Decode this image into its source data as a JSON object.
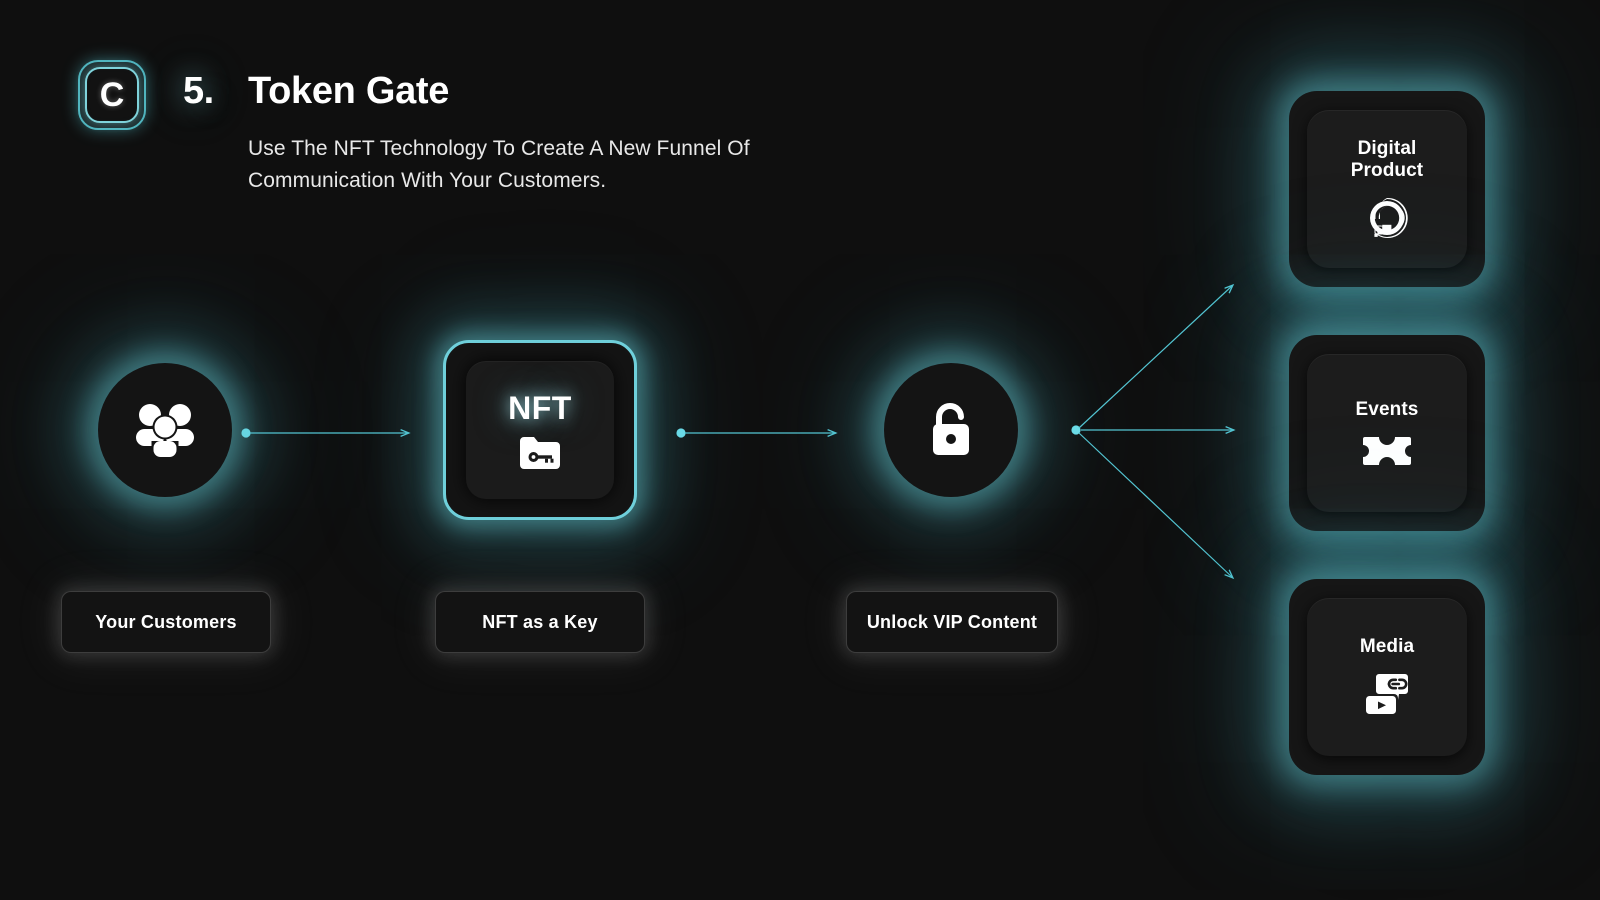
{
  "header": {
    "logo_letter": "C",
    "logo_icon": "rounded-square-c-logo",
    "step_number": "5.",
    "title": "Token Gate",
    "subtitle": "Use The NFT Technology To Create A New Funnel Of Communication With Your Customers."
  },
  "flow": {
    "nodes": [
      {
        "id": "customers",
        "icon": "people-group-icon",
        "label": "Your Customers",
        "type": "circle"
      },
      {
        "id": "nft",
        "icon": "folder-key-icon",
        "badge_text": "NFT",
        "label": "NFT as a Key",
        "type": "card"
      },
      {
        "id": "unlock",
        "icon": "open-padlock-icon",
        "label": "Unlock VIP Content",
        "type": "circle"
      }
    ],
    "outcomes": [
      {
        "id": "digital-product",
        "label": "Digital\nProduct",
        "label_line1": "Digital",
        "label_line2": "Product",
        "icon": "digitalocean-logo-icon"
      },
      {
        "id": "events",
        "label": "Events",
        "label_line1": "Events",
        "label_line2": "",
        "icon": "ticket-icon"
      },
      {
        "id": "media",
        "label": "Media",
        "label_line1": "Media",
        "label_line2": "",
        "icon": "media-link-play-icon"
      }
    ]
  },
  "colors": {
    "background": "#101010",
    "accent_cyan": "#6fd0db",
    "accent_glow": "#5ec8d4",
    "card_surface": "#161616",
    "inner_surface": "#1c1c1c",
    "text_primary": "#ffffff",
    "text_secondary": "#e8e8e8",
    "connector_stroke": "#55c7d4"
  }
}
